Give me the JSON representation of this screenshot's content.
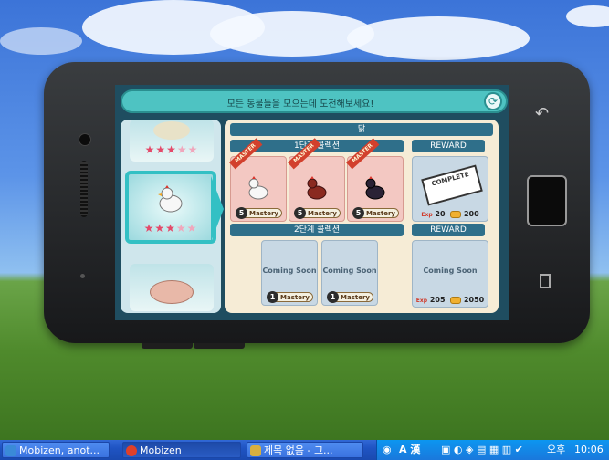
{
  "window": {
    "minimize_label": "−",
    "close_label": "✕"
  },
  "game": {
    "banner": "모든 동물들을 모으는데 도전해보세요!",
    "animal_title": "닭",
    "left_cards": [
      {
        "name": "goat",
        "stars_filled": 3,
        "stars_total": 5
      },
      {
        "name": "chicken",
        "stars_filled": 3,
        "stars_total": 5,
        "selected": true
      },
      {
        "name": "pig",
        "stars_filled": 0,
        "stars_total": 5
      }
    ],
    "stage1": {
      "label": "1단계 콜렉션",
      "reward_label": "REWARD",
      "slots": [
        {
          "badge": "MASTER",
          "mastery_num": "5",
          "mastery_label": "Mastery",
          "bird_color": "#f4f4f4"
        },
        {
          "badge": "MASTER",
          "mastery_num": "5",
          "mastery_label": "Mastery",
          "bird_color": "#8a2a20"
        },
        {
          "badge": "MASTER",
          "mastery_num": "5",
          "mastery_label": "Mastery",
          "bird_color": "#2a2235"
        }
      ],
      "reward": {
        "stamp": "COMPLETE",
        "exp_label": "Exp",
        "exp": "20",
        "coins": "200"
      }
    },
    "stage2": {
      "label": "2단계 콜렉션",
      "reward_label": "REWARD",
      "slots": [
        {
          "text": "Coming Soon",
          "mastery_num": "1",
          "mastery_label": "Mastery"
        },
        {
          "text": "Coming Soon",
          "mastery_num": "1",
          "mastery_label": "Mastery"
        }
      ],
      "reward": {
        "text": "Coming Soon",
        "exp_label": "Exp",
        "exp": "205",
        "coins": "2050"
      }
    }
  },
  "taskbar": {
    "tasks": [
      {
        "label": "Mobizen, anot...",
        "icon_color": "#3a8ad8"
      },
      {
        "label": "Mobizen",
        "icon_color": "#e0402a",
        "active": true
      },
      {
        "label": "제목 없음 - 그...",
        "icon_color": "#d8b040"
      }
    ],
    "tray": {
      "ime": "A 漢",
      "ampm": "오후",
      "time": "10:06"
    }
  }
}
